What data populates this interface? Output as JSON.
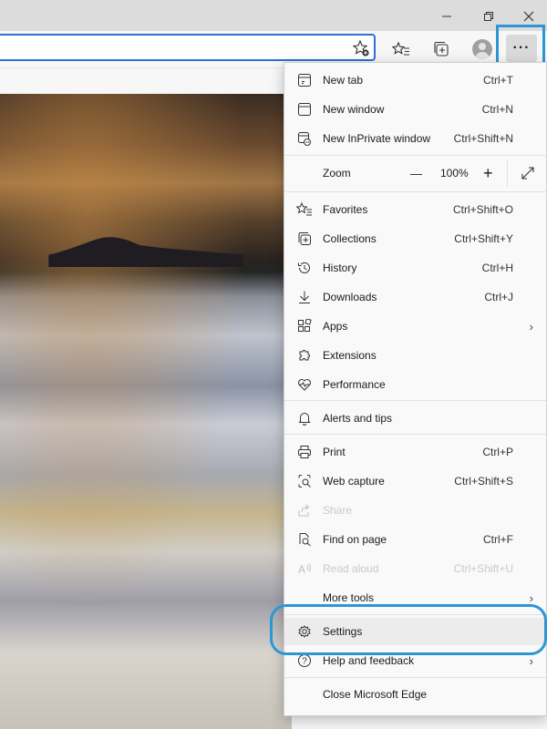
{
  "menu": {
    "new_tab": {
      "label": "New tab",
      "shortcut": "Ctrl+T"
    },
    "new_window": {
      "label": "New window",
      "shortcut": "Ctrl+N"
    },
    "new_inprivate": {
      "label": "New InPrivate window",
      "shortcut": "Ctrl+Shift+N"
    },
    "zoom": {
      "label": "Zoom",
      "minus": "—",
      "value": "100%",
      "plus": "+"
    },
    "favorites": {
      "label": "Favorites",
      "shortcut": "Ctrl+Shift+O"
    },
    "collections": {
      "label": "Collections",
      "shortcut": "Ctrl+Shift+Y"
    },
    "history": {
      "label": "History",
      "shortcut": "Ctrl+H"
    },
    "downloads": {
      "label": "Downloads",
      "shortcut": "Ctrl+J"
    },
    "apps": {
      "label": "Apps",
      "arrow": "›"
    },
    "extensions": {
      "label": "Extensions"
    },
    "performance": {
      "label": "Performance"
    },
    "alerts": {
      "label": "Alerts and tips"
    },
    "print": {
      "label": "Print",
      "shortcut": "Ctrl+P"
    },
    "web_capture": {
      "label": "Web capture",
      "shortcut": "Ctrl+Shift+S"
    },
    "share": {
      "label": "Share"
    },
    "find": {
      "label": "Find on page",
      "shortcut": "Ctrl+F"
    },
    "read_aloud": {
      "label": "Read aloud",
      "shortcut": "Ctrl+Shift+U"
    },
    "more_tools": {
      "label": "More tools",
      "arrow": "›"
    },
    "settings": {
      "label": "Settings"
    },
    "help": {
      "label": "Help and feedback",
      "arrow": "›"
    },
    "close": {
      "label": "Close Microsoft Edge"
    }
  },
  "toolbar": {
    "more_label": "···"
  },
  "colors": {
    "highlight_ring": "#2b97d7",
    "address_border": "#2f6fd6",
    "selected_bg": "#ececec"
  }
}
